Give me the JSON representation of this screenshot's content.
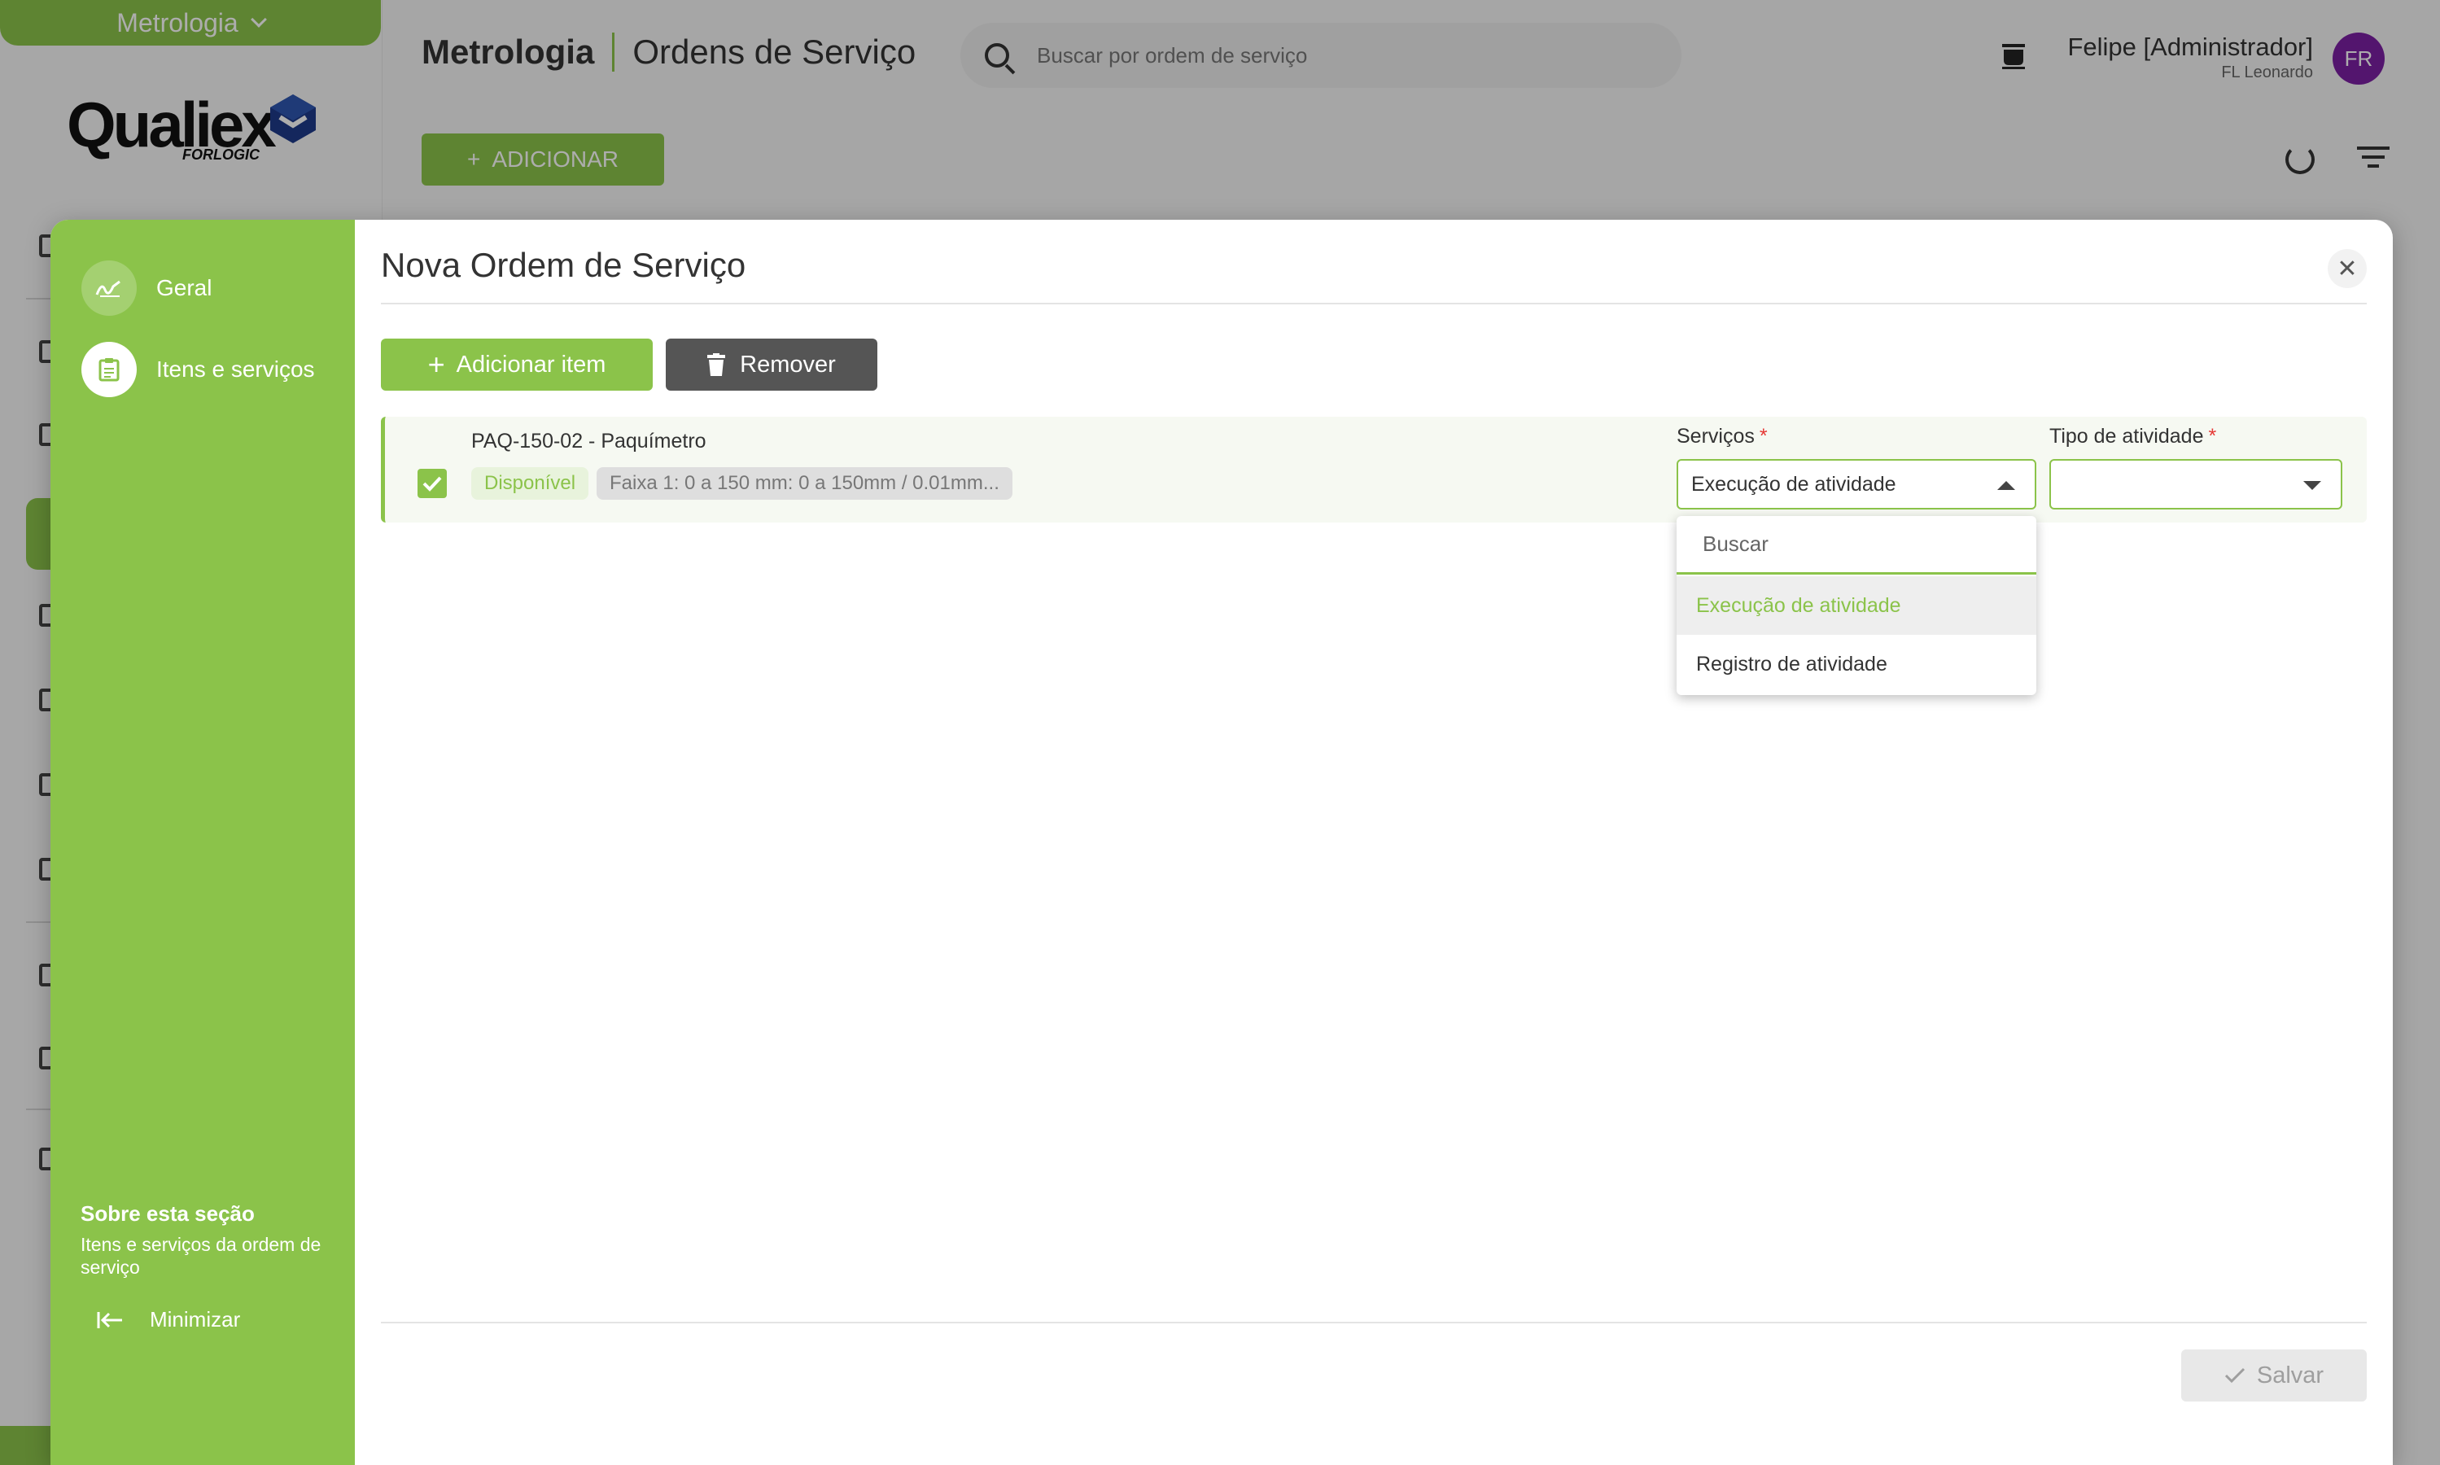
{
  "app_switcher": {
    "label": "Metrologia"
  },
  "logo": {
    "name": "Qualiex",
    "sub": "FORLOGIC"
  },
  "header": {
    "module": "Metrologia",
    "page": "Ordens de Serviço",
    "search_placeholder": "Buscar por ordem de serviço",
    "user_name": "Felipe [Administrador]",
    "user_org": "FL Leonardo",
    "avatar_initials": "FR",
    "add_button": "ADICIONAR"
  },
  "dialog": {
    "title": "Nova Ordem de Serviço",
    "steps": [
      {
        "label": "Geral",
        "icon": "signature-icon"
      },
      {
        "label": "Itens e serviços",
        "icon": "clipboard-icon"
      }
    ],
    "about_title": "Sobre esta seção",
    "about_desc": "Itens e serviços da ordem de serviço",
    "minimize_label": "Minimizar",
    "add_item_label": "Adicionar item",
    "remove_label": "Remover",
    "item": {
      "name": "PAQ-150-02 - Paquímetro",
      "status": "Disponível",
      "range": "Faixa 1: 0 a 150 mm: 0 a 150mm / 0.01mm...",
      "checked": true
    },
    "services_label": "Serviços",
    "services_value": "Execução de atividade",
    "activity_label": "Tipo de atividade",
    "activity_value": "",
    "dropdown": {
      "search_placeholder": "Buscar",
      "options": [
        "Execução de atividade",
        "Registro de atividade"
      ],
      "selected": "Execução de atividade"
    },
    "save_label": "Salvar"
  },
  "colors": {
    "brand": "#8bc34a",
    "danger": "#e53935",
    "avatar": "#7b1fa2",
    "remove_button": "#555555"
  }
}
